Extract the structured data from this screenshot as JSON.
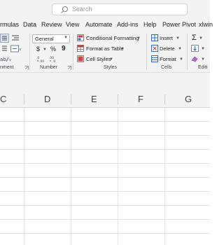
{
  "search": {
    "placeholder": "Search"
  },
  "menu_tabs": [
    "rmulas",
    "Data",
    "Review",
    "View",
    "Automate",
    "Add-ins",
    "Help",
    "Power Pivot",
    "xlwin"
  ],
  "ribbon": {
    "groups": {
      "alignment_partial": "nment",
      "number": "Number",
      "styles": "Styles",
      "cells": "Cells",
      "editing_partial": "Editi"
    },
    "number_format": "General",
    "number_buttons": {
      "currency": "$",
      "percent": "%",
      "comma": "9"
    },
    "styles": {
      "conditional_formatting": "Conditional Formatting",
      "format_as_table": "Format as Table",
      "cell_styles": "Cell Styles"
    },
    "cells": {
      "insert": "Insert",
      "delete": "Delete",
      "format": "Format"
    }
  },
  "columns": [
    "C",
    "D",
    "E",
    "F",
    "G"
  ],
  "colors": {
    "chrome": "#f3f3f3",
    "accent_red": "#c43e3e",
    "accent_blue": "#2b6cc4",
    "grid": "#e3e3e3"
  }
}
